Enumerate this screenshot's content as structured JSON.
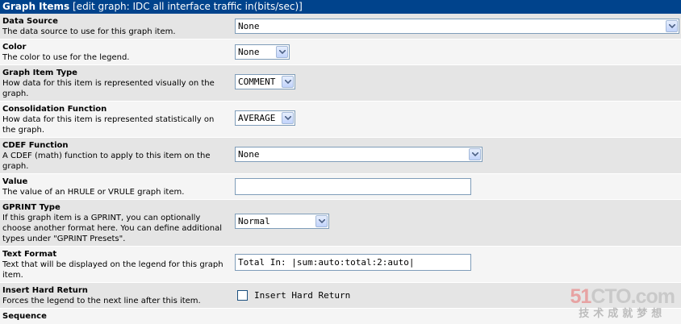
{
  "header": {
    "title": "Graph Items",
    "subtitle": "[edit graph: IDC all interface traffic in(bits/sec)]"
  },
  "fields": {
    "data_source": {
      "label": "Data Source",
      "desc": "The data source to use for this graph item.",
      "value": "None"
    },
    "color": {
      "label": "Color",
      "desc": "The color to use for the legend.",
      "value": "None"
    },
    "graph_item_type": {
      "label": "Graph Item Type",
      "desc": "How data for this item is represented visually on the graph.",
      "value": "COMMENT"
    },
    "consolidation_function": {
      "label": "Consolidation Function",
      "desc": "How data for this item is represented statistically on the graph.",
      "value": "AVERAGE"
    },
    "cdef_function": {
      "label": "CDEF Function",
      "desc": "A CDEF (math) function to apply to this item on the graph.",
      "value": "None"
    },
    "value": {
      "label": "Value",
      "desc": "The value of an HRULE or VRULE graph item.",
      "value": ""
    },
    "gprint_type": {
      "label": "GPRINT Type",
      "desc": "If this graph item is a GPRINT, you can optionally choose another format here. You can define additional types under \"GPRINT Presets\".",
      "value": "Normal"
    },
    "text_format": {
      "label": "Text Format",
      "desc": "Text that will be displayed on the legend for this graph item.",
      "value": "Total In: |sum:auto:total:2:auto|"
    },
    "insert_hard_return": {
      "label": "Insert Hard Return",
      "desc": "Forces the legend to the next line after this item.",
      "checkbox_label": "Insert Hard Return"
    },
    "sequence": {
      "label": "Sequence"
    }
  },
  "watermark": {
    "logo_prefix": "51",
    "logo_main": "CTO",
    "logo_suffix": ".com",
    "tagline": "技术成就梦想"
  },
  "colors": {
    "header_bg": "#00438c",
    "row_shade": "#e5e5e5",
    "row_light": "#f5f5f5"
  }
}
